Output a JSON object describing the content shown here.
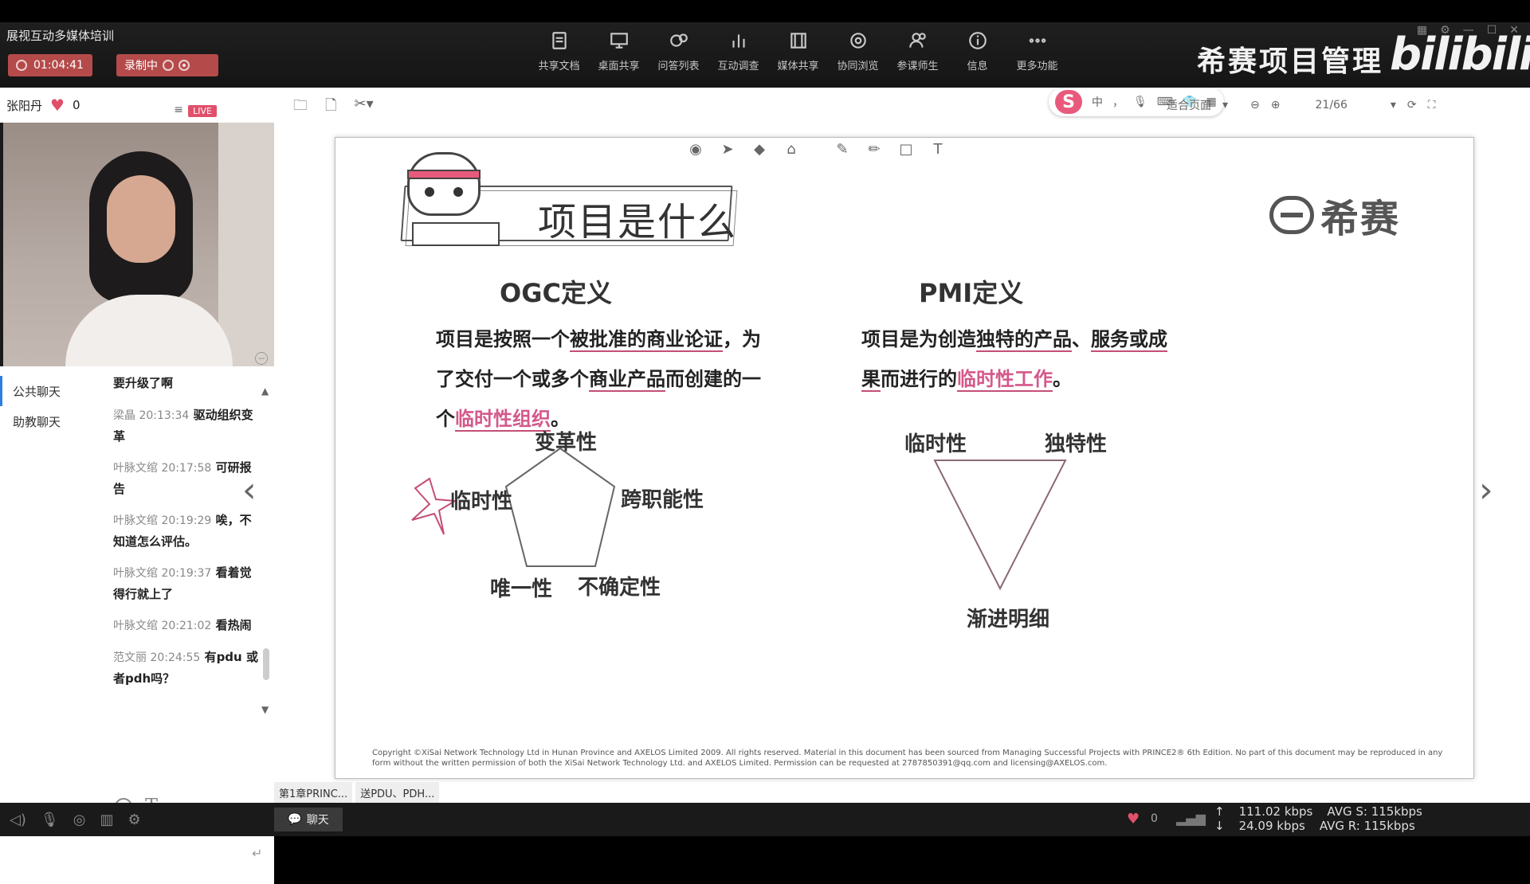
{
  "app": {
    "title": "展视互动多媒体培训"
  },
  "header": {
    "timer": "01:04:41",
    "recording_label": "录制中",
    "tools": [
      {
        "label": "共享文档",
        "icon": "doc-icon"
      },
      {
        "label": "桌面共享",
        "icon": "desktop-icon"
      },
      {
        "label": "问答列表",
        "icon": "qa-icon"
      },
      {
        "label": "互动调查",
        "icon": "poll-icon"
      },
      {
        "label": "媒体共享",
        "icon": "media-icon"
      },
      {
        "label": "协同浏览",
        "icon": "browse-icon"
      },
      {
        "label": "参课师生",
        "icon": "users-icon"
      },
      {
        "label": "信息",
        "icon": "info-icon"
      },
      {
        "label": "更多功能",
        "icon": "more-icon"
      }
    ],
    "brand": "希赛项目管理",
    "site_logo": "bilibili"
  },
  "presenter": {
    "name": "张阳丹",
    "likes": "0",
    "live_badge": "LIVE"
  },
  "chat": {
    "tabs": [
      "公共聊天",
      "助教聊天"
    ],
    "messages": [
      {
        "meta": "",
        "text": "要升级了啊"
      },
      {
        "meta": "梁晶 20:13:34",
        "text": "驱动组织变革"
      },
      {
        "meta": "叶脉文绾 20:17:58",
        "text": "可研报告"
      },
      {
        "meta": "叶脉文绾 20:19:29",
        "text": "唉，不知道怎么评估。"
      },
      {
        "meta": "叶脉文绾 20:19:37",
        "text": "看着觉得行就上了"
      },
      {
        "meta": "叶脉文绾 20:21:02",
        "text": "看热闹"
      },
      {
        "meta": "范文丽 20:24:55",
        "text": "有pdu 或者pdh吗？"
      }
    ]
  },
  "stage_toolbar": {
    "zoom_label": "适合页面",
    "page_indicator": "21/66"
  },
  "ime": {
    "labels": [
      "中",
      "，"
    ]
  },
  "slide": {
    "title": "项目是什么",
    "corner_logo": "希赛",
    "ogc": {
      "heading": "OGC定义",
      "line1_a": "项目是按照一个",
      "line1_b": "被批准的商业论证",
      "line1_c": "，为",
      "line2_a": "了交付一个或多个",
      "line2_b": "商业产品",
      "line2_c": "而创建的一",
      "line3_a": "个",
      "line3_b": "临时性组织",
      "line3_c": "。",
      "pentagon_labels": [
        "变革性",
        "跨职能性",
        "不确定性",
        "唯一性",
        "临时性"
      ]
    },
    "pmi": {
      "heading": "PMI定义",
      "line1_a": "项目是为创造",
      "line1_b": "独特的产品",
      "line1_c": "、",
      "line1_d": "服务或成",
      "line2_a": "果",
      "line2_b": "而进行的",
      "line2_c": "临时性工作",
      "line2_d": "。",
      "triangle_labels": [
        "临时性",
        "独特性",
        "渐进明细"
      ]
    },
    "copyright": "Copyright ©XiSai Network Technology Ltd in Hunan Province and AXELOS Limited 2009. All rights reserved. Material in this document has been sourced from Managing Successful Projects with PRINCE2® 6th Edition. No part of this document may be reproduced in any form without the written permission of both the XiSai Network Technology Ltd. and AXELOS Limited. Permission can be requested at 2787850391@qq.com and licensing@AXELOS.com."
  },
  "chapter_tabs": [
    "第1章PRINC...",
    "送PDU、PDH..."
  ],
  "bottom": {
    "chat_button": "聊天",
    "likes": "0",
    "upload_rate": "111.02 kbps",
    "download_rate": "24.09 kbps",
    "avg_s": "AVG S: 115kbps",
    "avg_r": "AVG R: 115kbps"
  },
  "colors": {
    "accent_pink": "#d4588a",
    "record_red": "#b54a4a",
    "header_bg": "#1a1a1a"
  }
}
